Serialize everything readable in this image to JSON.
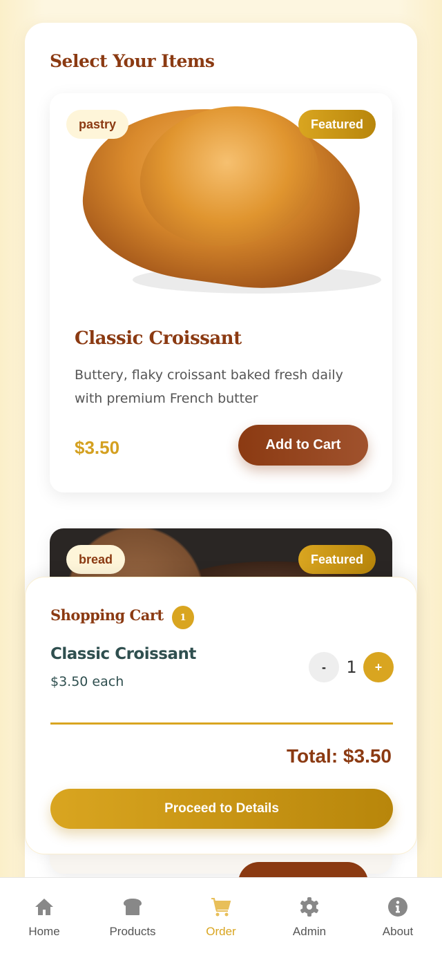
{
  "page": {
    "title": "Select Your Items"
  },
  "products": [
    {
      "category": "pastry",
      "badge": "Featured",
      "name": "Classic Croissant",
      "description": "Buttery, flaky croissant baked fresh daily with premium French butter",
      "price": "$3.50",
      "button": "Add to Cart"
    },
    {
      "category": "bread",
      "badge": "Featured"
    }
  ],
  "cart": {
    "title": "Shopping Cart",
    "count": "1",
    "items": [
      {
        "name": "Classic Croissant",
        "price": "$3.50 each",
        "qty": "1",
        "minus": "-",
        "plus": "+"
      }
    ],
    "total": "Total: $3.50",
    "proceed": "Proceed to Details"
  },
  "nav": {
    "items": [
      {
        "label": "Home",
        "icon": "home-icon"
      },
      {
        "label": "Products",
        "icon": "bread-icon"
      },
      {
        "label": "Order",
        "icon": "cart-icon",
        "active": true
      },
      {
        "label": "Admin",
        "icon": "gear-icon"
      },
      {
        "label": "About",
        "icon": "info-icon"
      }
    ]
  },
  "colors": {
    "brown": "#8b3a12",
    "gold": "#d9a520",
    "bg": "#fdf6e0"
  }
}
